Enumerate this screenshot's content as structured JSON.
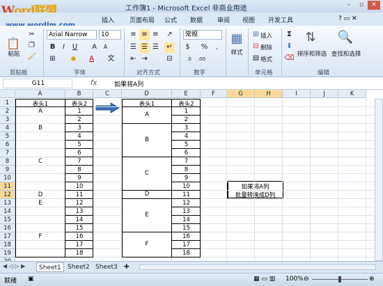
{
  "title": "工作簿1 - Microsoft Excel 非商业用途",
  "watermark": {
    "a": "W",
    "b": "ord",
    "c": "联盟",
    "url": "www.wordlm.com"
  },
  "tabs": [
    "插入",
    "页面布局",
    "公式",
    "数据",
    "审阅",
    "视图",
    "开发工具"
  ],
  "ribbon": {
    "paste": "粘贴",
    "font_name": "Arial Narrow",
    "font_size": "10",
    "number_format": "常规",
    "style": "样式",
    "insert": "插入",
    "delete": "删除",
    "format": "格式",
    "sort": "排序和筛选",
    "find": "查找和选择",
    "groups": {
      "clipboard": "剪贴板",
      "font": "字体",
      "align": "对齐方式",
      "number": "数字",
      "cells": "单元格",
      "edit": "编辑"
    }
  },
  "formula_bar": {
    "name_box": "G11",
    "fx": "fx",
    "content": "如果将A列"
  },
  "columns": [
    "A",
    "B",
    "C",
    "D",
    "E",
    "F",
    "G",
    "H",
    "I",
    "J",
    "K"
  ],
  "rows": [
    "1",
    "2",
    "3",
    "4",
    "5",
    "6",
    "7",
    "8",
    "9",
    "10",
    "11",
    "12",
    "13",
    "14",
    "15",
    "16",
    "17",
    "18",
    "19",
    "20"
  ],
  "colA": [
    "表头1",
    "A",
    "",
    "B",
    "",
    "",
    "",
    "C",
    "",
    "",
    "",
    "D",
    "E",
    "",
    "",
    "",
    "F",
    "",
    ""
  ],
  "colB": [
    "表头2",
    "1",
    "2",
    "3",
    "4",
    "5",
    "6",
    "7",
    "8",
    "9",
    "10",
    "11",
    "12",
    "13",
    "14",
    "15",
    "16",
    "17",
    "18"
  ],
  "merged_d": [
    "A",
    "B",
    "C",
    "D",
    "E",
    "F"
  ],
  "note": [
    "如果将A列",
    "批量转换成D列"
  ],
  "sheets": [
    "Sheet1",
    "Sheet2",
    "Sheet3"
  ],
  "status": {
    "ready": "就绪",
    "zoom": "100%"
  }
}
